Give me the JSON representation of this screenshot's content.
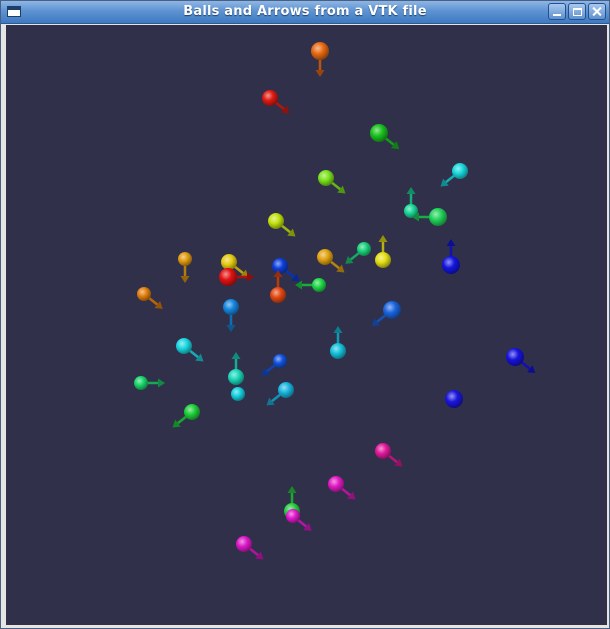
{
  "window": {
    "title": "Balls and Arrows from a VTK file",
    "controls": {
      "minimize": "minimize",
      "maximize": "maximize",
      "close": "close"
    }
  },
  "scene": {
    "background": "#31304a",
    "glyphs": [
      {
        "color": "#e86a12",
        "arrow": "down"
      },
      {
        "color": "#e01a12",
        "arrow": "down-right"
      },
      {
        "color": "#19c21e",
        "arrow": "down-right"
      },
      {
        "color": "#18d8dc",
        "arrow": "down-left"
      },
      {
        "color": "#7be31a",
        "arrow": "down-right"
      },
      {
        "color": "#c2e20f",
        "arrow": "down-right"
      },
      {
        "color": "#1ad899",
        "arrow": "up"
      },
      {
        "color": "#21d45a",
        "arrow": "left"
      },
      {
        "color": "#e09c12",
        "arrow": "down"
      },
      {
        "color": "#e6cc12",
        "arrow": "down-right"
      },
      {
        "color": "#e21212",
        "arrow": "right"
      },
      {
        "color": "#0c3fdc",
        "arrow": "down-right"
      },
      {
        "color": "#e2a412",
        "arrow": "down-right"
      },
      {
        "color": "#1ad27a",
        "arrow": "down-left"
      },
      {
        "color": "#e4df14",
        "arrow": "up"
      },
      {
        "color": "#1315e0",
        "arrow": "up"
      },
      {
        "color": "#e2800e",
        "arrow": "down-right"
      },
      {
        "color": "#e34812",
        "arrow": "up"
      },
      {
        "color": "#20d848",
        "arrow": "left"
      },
      {
        "color": "#1687e0",
        "arrow": "down"
      },
      {
        "color": "#1a64df",
        "arrow": "down-left"
      },
      {
        "color": "#1ad7e2",
        "arrow": "down-right"
      },
      {
        "color": "#14c2dc",
        "arrow": "up"
      },
      {
        "color": "#1254df",
        "arrow": "down-left"
      },
      {
        "color": "#1ad8b8",
        "arrow": "up"
      },
      {
        "color": "#19b5e0",
        "arrow": "down-left"
      },
      {
        "color": "#1ad56a",
        "arrow": "right"
      },
      {
        "color": "#14d0de",
        "arrow": "none"
      },
      {
        "color": "#1613de",
        "arrow": "down-right"
      },
      {
        "color": "#1ecf3a",
        "arrow": "down-left"
      },
      {
        "color": "#1a16de",
        "arrow": "none"
      },
      {
        "color": "#e01a9c",
        "arrow": "down-right"
      },
      {
        "color": "#e21ac4",
        "arrow": "down-right"
      },
      {
        "color": "#26d13e",
        "arrow": "up"
      },
      {
        "color": "#dd18c8",
        "arrow": "down-right"
      },
      {
        "color": "#e21ad0",
        "arrow": "down-right"
      }
    ]
  }
}
